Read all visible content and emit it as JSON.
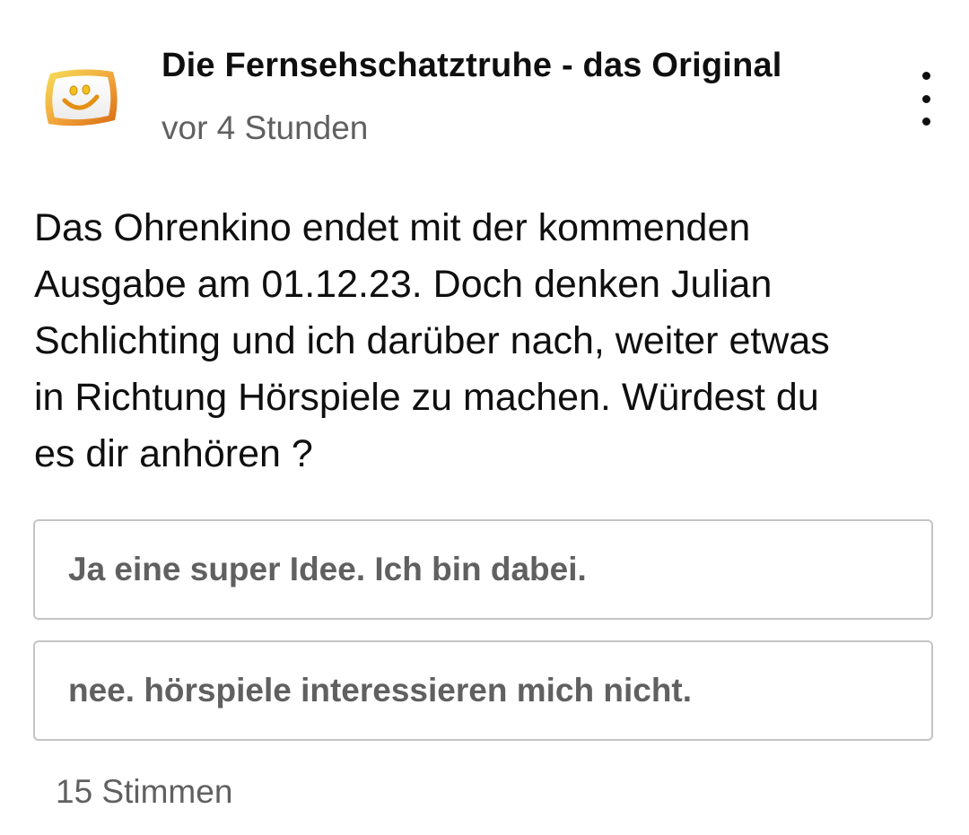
{
  "channel": {
    "name": "Die Fernsehschatztruhe - das Original",
    "avatar_icon": "smiley-tv-logo-icon",
    "timestamp": "vor 4 Stunden"
  },
  "menu": {
    "icon": "more-vertical-icon"
  },
  "post": {
    "lines": [
      "Das Ohrenkino endet mit der kommenden",
      "Ausgabe am 01.12.23. Doch denken Julian",
      "Schlichting und ich darüber nach, weiter etwas",
      "in Richtung Hörspiele zu machen. Würdest du",
      "es dir anhören ?"
    ]
  },
  "poll": {
    "options": [
      {
        "label": "Ja eine super Idee. Ich bin dabei."
      },
      {
        "label": "nee. hörspiele interessieren mich nicht."
      }
    ],
    "vote_count": "15 Stimmen"
  },
  "colors": {
    "text_primary": "#0f0f0f",
    "text_secondary": "#606060",
    "option_border": "#c4c4c4",
    "logo_yellow": "#f2d21b",
    "logo_orange": "#e07a10"
  }
}
